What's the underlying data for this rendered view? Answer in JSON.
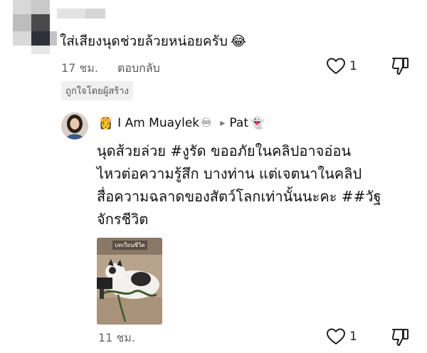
{
  "comment1": {
    "text": "ใส่เสียงนุดช่วยล้วยหน่อยครับ",
    "emoji": "😂",
    "time": "17 ชม.",
    "reply_label": "ตอบกลับ",
    "like_count": "1",
    "creator_badge": "ถูกใจโดยผู้สร้าง"
  },
  "reply": {
    "author_prefix_emoji": "👸",
    "author_name": "I Am Muaylek",
    "author_suffix_emoji": "♾",
    "reply_to_arrow": "▸",
    "reply_to_name": "Pat",
    "reply_to_emoji": "👻",
    "lines": [
      "นุดส้วยล่วย #งูรัด ขออภัยในคลิปอาจอ่อน",
      "ไหวต่อความรู้สึก บางท่าน แต่เจตนาในคลิป",
      "สื่อความฉลาดของสัตว์โลกเท่านั้นนะคะ ##วัฐ",
      "จักรชีวิต"
    ],
    "sticker_caption": "บทเรียนชีวิต",
    "time": "11 ชม.",
    "like_count": "1"
  },
  "colors": {
    "text": "#111111",
    "meta": "#666666",
    "pill_bg": "#f0f0f0"
  }
}
